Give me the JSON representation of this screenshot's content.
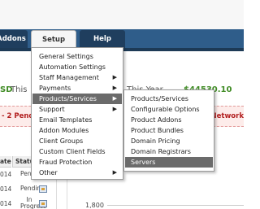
{
  "nav": {
    "tabs": [
      {
        "label": "Addons"
      },
      {
        "label": "Setup"
      },
      {
        "label": "Help"
      }
    ]
  },
  "stats": {
    "left_fragment": "SD",
    "this_fragment": "This",
    "right_label": "This Year",
    "right_value": "$44530.10 USD"
  },
  "alert": {
    "text": "- 2 Pend",
    "right_fragment": "Network"
  },
  "table": {
    "headers": {
      "date": "ate",
      "status": "Status"
    },
    "rows": [
      {
        "date": "014",
        "status": "Pending"
      },
      {
        "date": "014",
        "status": "Pending"
      },
      {
        "date": "014",
        "status": "In Progress"
      }
    ]
  },
  "graph": {
    "y_label": "1,800"
  },
  "setup_menu": {
    "items": [
      {
        "label": "General Settings",
        "has_submenu": false
      },
      {
        "label": "Automation Settings",
        "has_submenu": false
      },
      {
        "label": "Staff Management",
        "has_submenu": true
      },
      {
        "label": "Payments",
        "has_submenu": true
      },
      {
        "label": "Products/Services",
        "has_submenu": true,
        "active": true
      },
      {
        "label": "Support",
        "has_submenu": true
      },
      {
        "label": "Email Templates",
        "has_submenu": false
      },
      {
        "label": "Addon Modules",
        "has_submenu": false
      },
      {
        "label": "Client Groups",
        "has_submenu": false
      },
      {
        "label": "Custom Client Fields",
        "has_submenu": false
      },
      {
        "label": "Fraud Protection",
        "has_submenu": false
      },
      {
        "label": "Other",
        "has_submenu": true
      }
    ]
  },
  "submenu": {
    "items": [
      {
        "label": "Products/Services"
      },
      {
        "label": "Configurable Options"
      },
      {
        "label": "Product Addons"
      },
      {
        "label": "Product Bundles"
      },
      {
        "label": "Domain Pricing"
      },
      {
        "label": "Domain Registrars"
      },
      {
        "label": "Servers",
        "active": true
      }
    ]
  },
  "icons": {
    "submenu_arrow": "triangle-right-icon",
    "edit": "edit-icon"
  }
}
